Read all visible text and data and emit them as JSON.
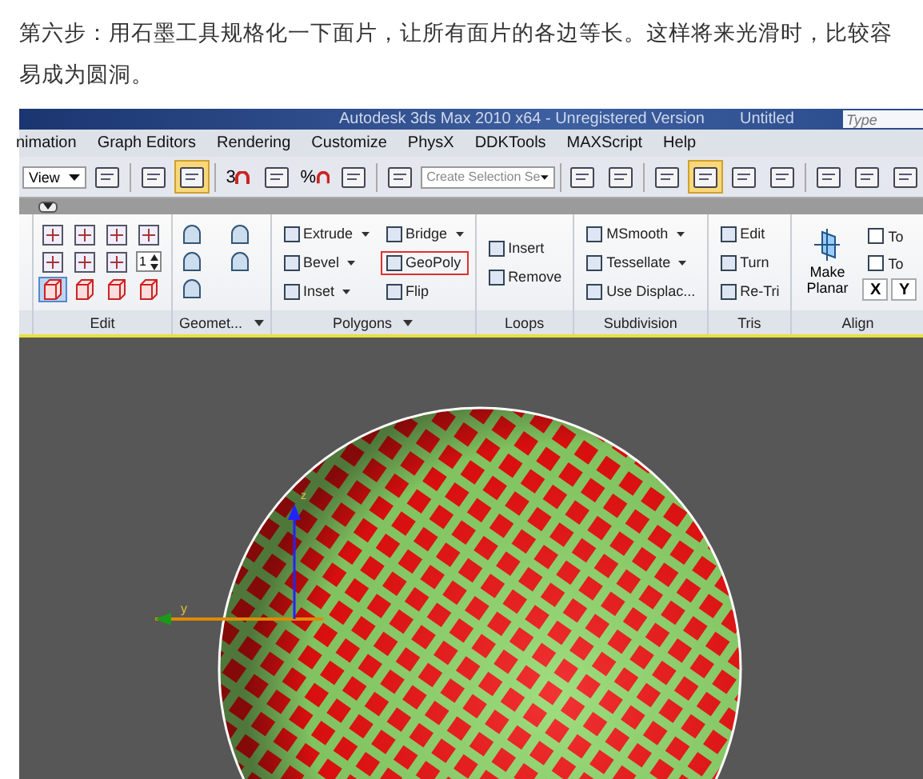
{
  "article": {
    "paragraph": "第六步：用石墨工具规格化一下面片，让所有面片的各边等长。这样将来光滑时，比较容易成为圆洞。"
  },
  "app_window": {
    "title": "Autodesk 3ds Max  2010 x64  - Unregistered Version",
    "document": "Untitled",
    "search_placeholder": "Type"
  },
  "menu": [
    "nimation",
    "Graph Editors",
    "Rendering",
    "Customize",
    "PhysX",
    "DDKTools",
    "MAXScript",
    "Help"
  ],
  "toolbar": [
    {
      "kind": "select",
      "value": "View"
    },
    {
      "kind": "icon",
      "active": false
    },
    {
      "kind": "separator"
    },
    {
      "kind": "icon",
      "active": false
    },
    {
      "kind": "icon",
      "active": true
    },
    {
      "kind": "separator"
    },
    {
      "kind": "snap",
      "label": "3"
    },
    {
      "kind": "icon",
      "active": false
    },
    {
      "kind": "snap",
      "label": "%"
    },
    {
      "kind": "icon",
      "active": false
    },
    {
      "kind": "separator"
    },
    {
      "kind": "icon",
      "active": false
    },
    {
      "kind": "select",
      "placeholder": "Create Selection Se"
    },
    {
      "kind": "separator"
    },
    {
      "kind": "icon",
      "active": false
    },
    {
      "kind": "icon",
      "active": false
    },
    {
      "kind": "separator"
    },
    {
      "kind": "icon",
      "active": false
    },
    {
      "kind": "icon",
      "active": true
    },
    {
      "kind": "icon",
      "active": false
    },
    {
      "kind": "icon",
      "active": false
    },
    {
      "kind": "separator"
    },
    {
      "kind": "icon",
      "active": false
    },
    {
      "kind": "icon",
      "active": false
    },
    {
      "kind": "icon",
      "active": false
    }
  ],
  "ribbon": [
    {
      "kind": "stub"
    },
    {
      "kind": "edit",
      "label": "Edit",
      "dropdown": false,
      "spinner": "1"
    },
    {
      "kind": "geometry",
      "label": "Geomet...",
      "dropdown": true
    },
    {
      "kind": "commands",
      "label": "Polygons",
      "dropdown": true,
      "items": [
        {
          "label": "Extrude",
          "dropdown": true,
          "highlighted": false
        },
        {
          "label": "Bridge",
          "dropdown": true,
          "highlighted": false
        },
        {
          "label": "Bevel",
          "dropdown": true,
          "highlighted": false
        },
        {
          "label": "GeoPoly",
          "dropdown": false,
          "highlighted": true
        },
        {
          "label": "Inset",
          "dropdown": true,
          "highlighted": false
        },
        {
          "label": "Flip",
          "dropdown": false,
          "highlighted": false
        }
      ]
    },
    {
      "kind": "commands",
      "label": "Loops",
      "dropdown": false,
      "items": [
        {
          "label": "Insert",
          "dropdown": false,
          "highlighted": false
        },
        {
          "label": "Remove",
          "dropdown": false,
          "highlighted": false
        }
      ]
    },
    {
      "kind": "commands",
      "label": "Subdivision",
      "dropdown": false,
      "items": [
        {
          "label": "MSmooth",
          "dropdown": true,
          "highlighted": false
        },
        {
          "label": "Tessellate",
          "dropdown": true,
          "highlighted": false
        },
        {
          "label": "Use Displac...",
          "dropdown": false,
          "highlighted": false
        }
      ]
    },
    {
      "kind": "commands",
      "label": "Tris",
      "dropdown": false,
      "items": [
        {
          "label": "Edit",
          "dropdown": false,
          "highlighted": false
        },
        {
          "label": "Turn",
          "dropdown": false,
          "highlighted": false
        },
        {
          "label": "Re-Tri",
          "dropdown": false,
          "highlighted": false
        }
      ]
    },
    {
      "kind": "align",
      "label": "Align",
      "dropdown": false,
      "big_button": "Make Planar",
      "items": [
        "To",
        "To"
      ],
      "axes": [
        "X",
        "Y"
      ]
    }
  ],
  "viewport": {
    "axis_labels": [
      "y",
      "z"
    ]
  }
}
